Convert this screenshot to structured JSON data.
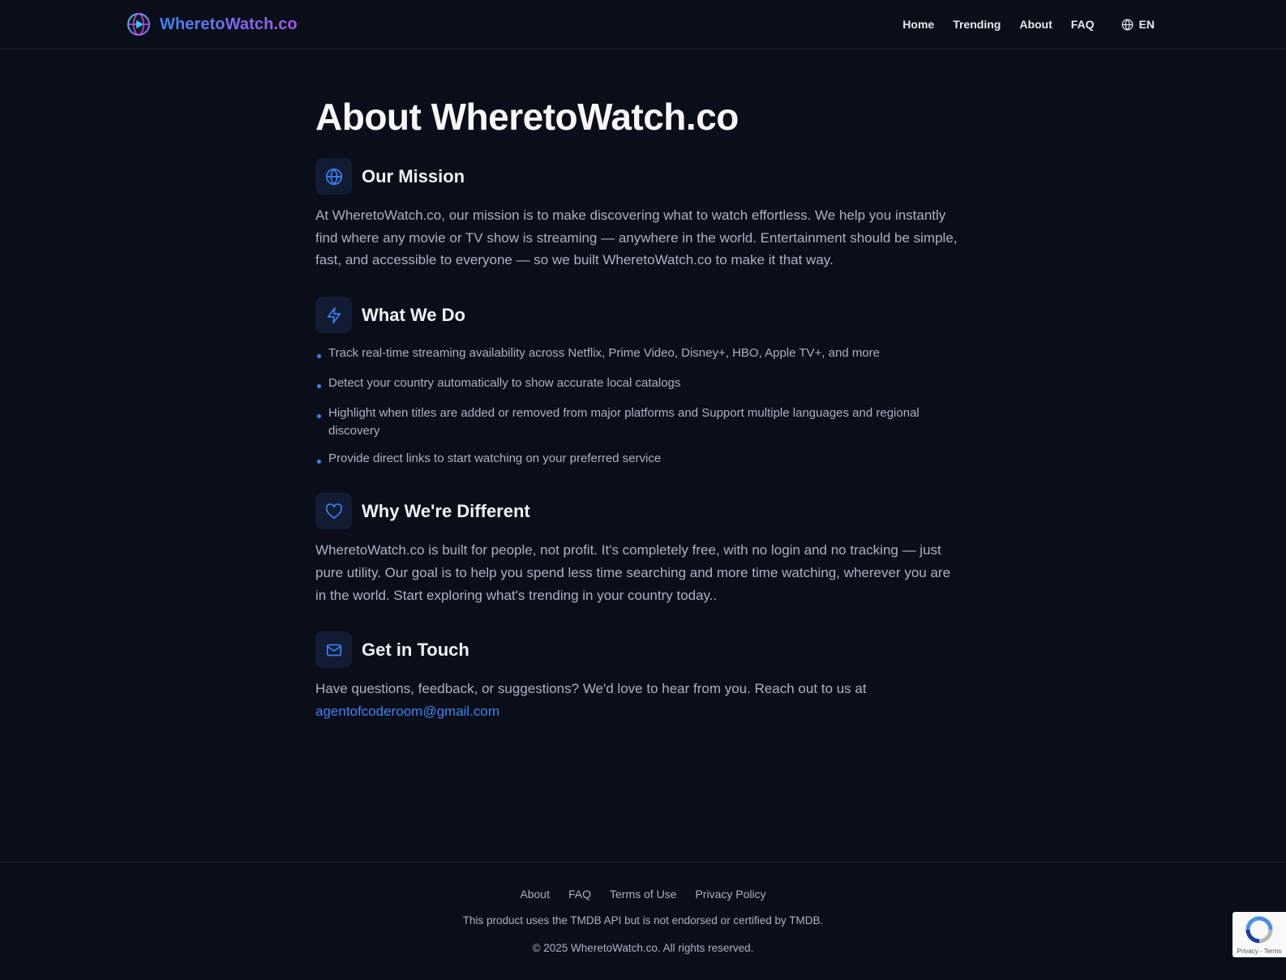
{
  "header": {
    "brand": "WheretoWatch.co",
    "nav": [
      "Home",
      "Trending",
      "About",
      "FAQ"
    ],
    "language": "EN"
  },
  "page": {
    "title": "About WheretoWatch.co"
  },
  "sections": {
    "mission": {
      "title": "Our Mission",
      "body": "At WheretoWatch.co, our mission is to make discovering what to watch effortless. We help you instantly find where any movie or TV show is streaming — anywhere in the world. Entertainment should be simple, fast, and accessible to everyone — so we built WheretoWatch.co to make it that way."
    },
    "what_we_do": {
      "title": "What We Do",
      "items": [
        "Track real-time streaming availability across Netflix, Prime Video, Disney+, HBO, Apple TV+, and more",
        "Detect your country automatically to show accurate local catalogs",
        "Highlight when titles are added or removed from major platforms and Support multiple languages and regional discovery",
        "Provide direct links to start watching on your preferred service"
      ]
    },
    "different": {
      "title": "Why We're Different",
      "body": "WheretoWatch.co is built for people, not profit. It's completely free, with no login and no tracking — just pure utility. Our goal is to help you spend less time searching and more time watching, wherever you are in the world. Start exploring what's trending in your country today.."
    },
    "contact": {
      "title": "Get in Touch",
      "body": "Have questions, feedback, or suggestions? We'd love to hear from you. Reach out to us at",
      "email": "agentofcoderoom@gmail.com"
    }
  },
  "footer": {
    "links": [
      "About",
      "FAQ",
      "Terms of Use",
      "Privacy Policy"
    ],
    "note": "This product uses the TMDB API but is not endorsed or certified by TMDB.",
    "copyright": "© 2025 WheretoWatch.co. All rights reserved."
  },
  "recaptcha": {
    "terms": "Privacy - Terms"
  },
  "colors": {
    "background": "#0a0e18",
    "accent": "#3b82f6",
    "brand_gradient_end": "#a855f7",
    "icon_box": "#111c33",
    "muted_text": "#a9b3c1"
  }
}
